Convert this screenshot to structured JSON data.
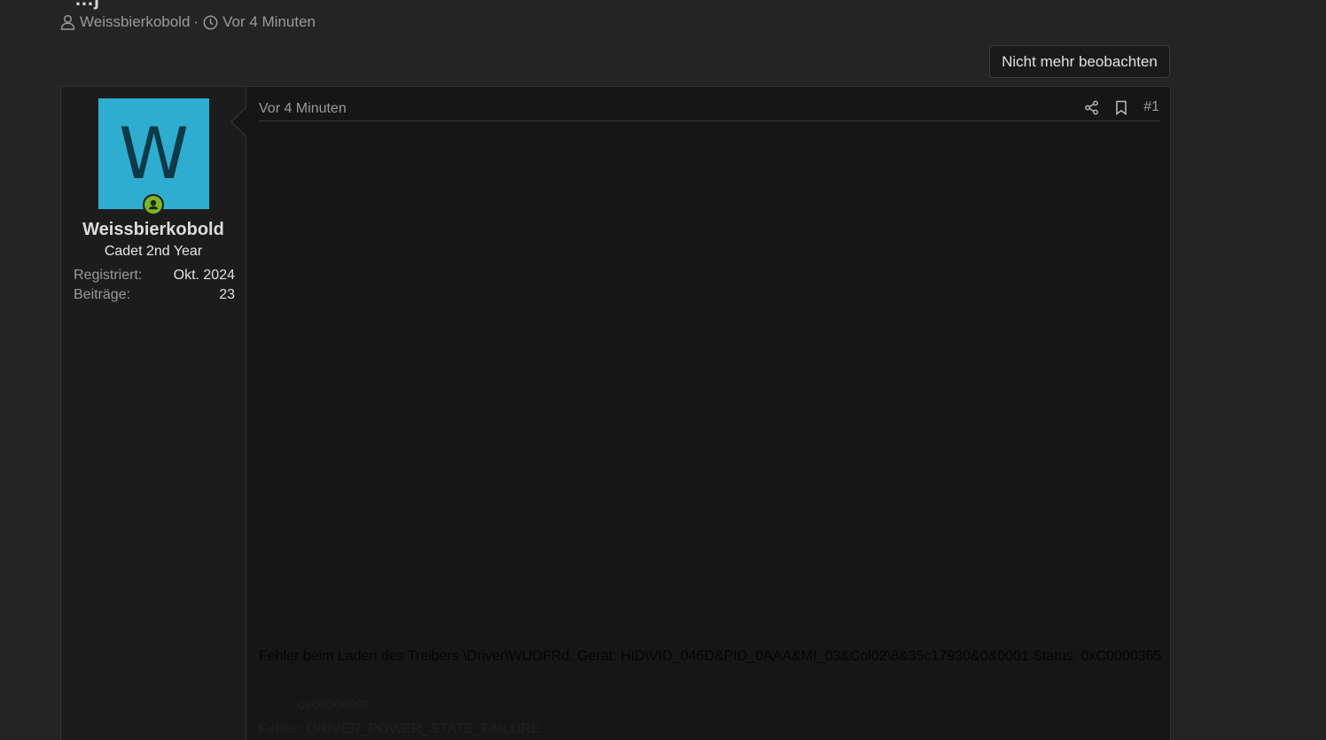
{
  "thread": {
    "title_fragment": "…j",
    "author": "Weissbierkobold",
    "separator": "·",
    "time": "Vor 4 Minuten"
  },
  "watch_button": "Nicht mehr beobachten",
  "post": {
    "user": {
      "avatar_letter": "W",
      "avatar_color": "#2fadd1",
      "name": "Weissbierkobold",
      "title": "Cadet 2nd Year",
      "registered_label": "Registriert:",
      "registered_value": "Okt. 2024",
      "posts_label": "Beiträge:",
      "posts_value": "23"
    },
    "date": "Vor 4 Minuten",
    "number": "#1",
    "body": {
      "line1": "Fehler beim Laden des Treibers \\Driver\\WUDFRd. Gerät: HID\\VID_046D&PID_0AAA&MI_03&Col02\\8&35c17930&0&0001 Status: 0xC0000365",
      "line2": "0x0000009F",
      "line3": "Fehler: DRIVER_POWER_STATE_FAILURE"
    }
  },
  "colors": {
    "background": "#242424",
    "post_background": "#161616",
    "online": "#7fb52a"
  },
  "icons": {
    "author": "user-icon",
    "time": "clock-icon",
    "share": "share-icon",
    "bookmark": "bookmark-icon",
    "online": "online-status-icon"
  }
}
